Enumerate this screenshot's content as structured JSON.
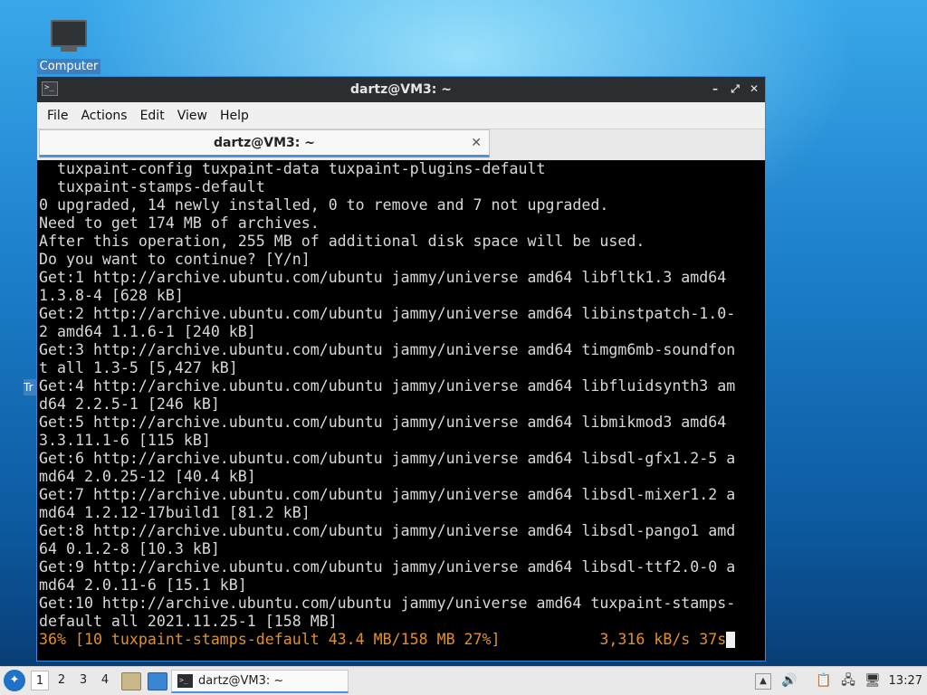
{
  "desktop": {
    "icon_label": "Computer",
    "partial_icon_label": "Tr"
  },
  "window": {
    "title": "dartz@VM3: ~",
    "controls": {
      "minimize": "–",
      "maximize": "⤢",
      "close": "✕"
    },
    "menu": [
      "File",
      "Actions",
      "Edit",
      "View",
      "Help"
    ],
    "tab": {
      "title": "dartz@VM3: ~",
      "close": "✕"
    }
  },
  "terminal": {
    "lines": [
      "  tuxpaint-config tuxpaint-data tuxpaint-plugins-default",
      "  tuxpaint-stamps-default",
      "0 upgraded, 14 newly installed, 0 to remove and 7 not upgraded.",
      "Need to get 174 MB of archives.",
      "After this operation, 255 MB of additional disk space will be used.",
      "Do you want to continue? [Y/n]",
      "Get:1 http://archive.ubuntu.com/ubuntu jammy/universe amd64 libfltk1.3 amd64",
      "1.3.8-4 [628 kB]",
      "Get:2 http://archive.ubuntu.com/ubuntu jammy/universe amd64 libinstpatch-1.0-",
      "2 amd64 1.1.6-1 [240 kB]",
      "Get:3 http://archive.ubuntu.com/ubuntu jammy/universe amd64 timgm6mb-soundfon",
      "t all 1.3-5 [5,427 kB]",
      "Get:4 http://archive.ubuntu.com/ubuntu jammy/universe amd64 libfluidsynth3 am",
      "d64 2.2.5-1 [246 kB]",
      "Get:5 http://archive.ubuntu.com/ubuntu jammy/universe amd64 libmikmod3 amd64",
      "3.3.11.1-6 [115 kB]",
      "Get:6 http://archive.ubuntu.com/ubuntu jammy/universe amd64 libsdl-gfx1.2-5 a",
      "md64 2.0.25-12 [40.4 kB]",
      "Get:7 http://archive.ubuntu.com/ubuntu jammy/universe amd64 libsdl-mixer1.2 a",
      "md64 1.2.12-17build1 [81.2 kB]",
      "Get:8 http://archive.ubuntu.com/ubuntu jammy/universe amd64 libsdl-pango1 amd",
      "64 0.1.2-8 [10.3 kB]",
      "Get:9 http://archive.ubuntu.com/ubuntu jammy/universe amd64 libsdl-ttf2.0-0 a",
      "md64 2.0.11-6 [15.1 kB]",
      "Get:10 http://archive.ubuntu.com/ubuntu jammy/universe amd64 tuxpaint-stamps-",
      "default all 2021.11.25-1 [158 MB]"
    ],
    "progress_line": "36% [10 tuxpaint-stamps-default 43.4 MB/158 MB 27%]           3,316 kB/s 37s",
    "colors": {
      "text": "#d8d8d8",
      "progress": "#e0902a",
      "background": "#000000"
    }
  },
  "taskbar": {
    "workspaces": [
      "1",
      "2",
      "3",
      "4"
    ],
    "active_workspace": "1",
    "launchers": [
      "file-manager-icon",
      "show-desktop-icon"
    ],
    "task_label": "dartz@VM3: ~",
    "tray_icons": [
      "notification-icon",
      "volume-icon",
      "clipboard-icon",
      "network-icon",
      "update-icon"
    ],
    "clock": "13:27"
  },
  "colors": {
    "accent": "#4d93d8",
    "titlebar": "#2b2e31"
  }
}
